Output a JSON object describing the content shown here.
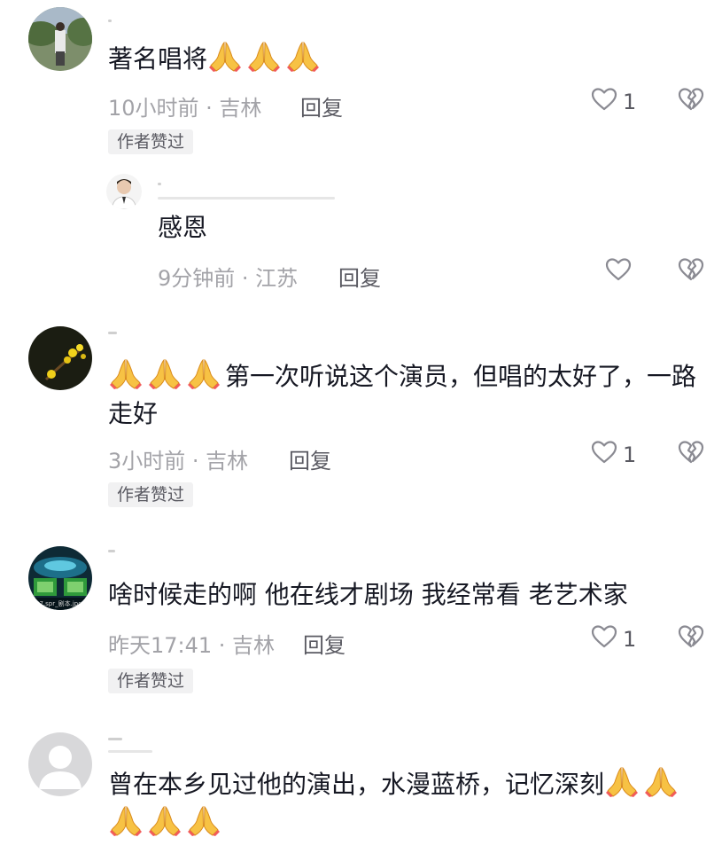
{
  "comments": [
    {
      "text": "著名唱将",
      "prayers_after": 3,
      "time_location": "10小时前 · 吉林",
      "reply_label": "回复",
      "likes": "1",
      "badge": "作者赞过",
      "reply": {
        "text": "感恩",
        "time_location": "9分钟前 · 江苏",
        "reply_label": "回复"
      }
    },
    {
      "prayers_before": 3,
      "text": "第一次听说这个演员，但唱的太好了，一路走好",
      "time_location": "3小时前 · 吉林",
      "reply_label": "回复",
      "likes": "1",
      "badge": "作者赞过"
    },
    {
      "text": "啥时候走的啊 他在线才剧场 我经常看 老艺术家",
      "avatar_caption": "17.spr_剧本.jpg",
      "time_location": "昨天17:41 · 吉林",
      "reply_label": "回复",
      "likes": "1",
      "badge": "作者赞过"
    },
    {
      "text": "曾在本乡见过他的演出，水漫蓝桥，记忆深刻",
      "prayers_after": 5
    }
  ],
  "icons": {
    "like": "heart-outline-icon",
    "dislike": "broken-heart-icon",
    "prayer": "folded-hands-emoji"
  }
}
